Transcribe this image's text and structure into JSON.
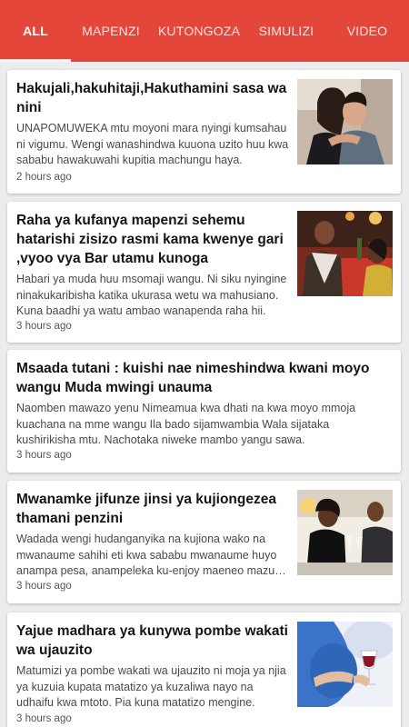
{
  "tabs": [
    {
      "label": "ALL",
      "active": true
    },
    {
      "label": "MAPENZI",
      "active": false
    },
    {
      "label": "KUTONGOZA",
      "active": false
    },
    {
      "label": "SIMULIZI",
      "active": false
    },
    {
      "label": "VIDEO",
      "active": false
    }
  ],
  "colors": {
    "header": "#e4473a",
    "background": "#ececec",
    "card": "#ffffff"
  },
  "articles": [
    {
      "title": "Hakujali,hakuhitaji,Hakuthamini sasa wa nini",
      "excerpt": "UNAPOMUWEKA mtu moyoni mara nyingi kumsahau ni vigumu. Wengi wanashindwa kuuona uzito huu kwa sababu hawakuwahi kupitia machungu haya.",
      "time": "2 hours ago",
      "image": "couple-embrace-photo"
    },
    {
      "title": "Raha ya kufanya mapenzi sehemu hatarishi zisizo rasmi kama kwenye gari ,vyoo vya Bar utamu kunoga",
      "excerpt": "Habari ya muda huu msomaji wangu. Ni siku nyingine ninakukaribisha katika ukurasa wetu wa mahusiano. Kuna baadhi ya watu ambao wanapenda raha hii.",
      "time": "3 hours ago",
      "image": "couple-dinner-photo"
    },
    {
      "title": "Msaada tutani : kuishi nae nimeshindwa kwani moyo wangu Muda mwingi unauma",
      "excerpt": "Naomben mawazo yenu Nimeamua kwa dhati na kwa moyo mmoja kuachana na mme wangu Ila bado sijamwambia Wala sijataka kushirikisha mtu. Nachotaka niweke mambo yangu sawa.",
      "time": "3 hours ago",
      "image": ""
    },
    {
      "title": "Mwanamke jifunze jinsi ya kujiongezea thamani penzini",
      "excerpt": "Wadada wengi hudanganyika na kujiona wako na mwanaume sahihi eti kwa sababu mwanaume huyo anampa pesa, anampeleka ku-enjoy maeneo mazuri na mengineyo.",
      "time": "3 hours ago",
      "image": "couple-toast-photo"
    },
    {
      "title": "Yajue madhara ya kunywa pombe wakati wa ujauzito",
      "excerpt": "Matumizi ya pombe wakati wa ujauzito ni moja ya njia ya kuzuia kupata matatizo ya kuzaliwa nayo na udhaifu kwa mtoto. Pia kuna matatizo mengine.",
      "time": "3 hours ago",
      "image": "pregnant-wine-photo"
    }
  ]
}
